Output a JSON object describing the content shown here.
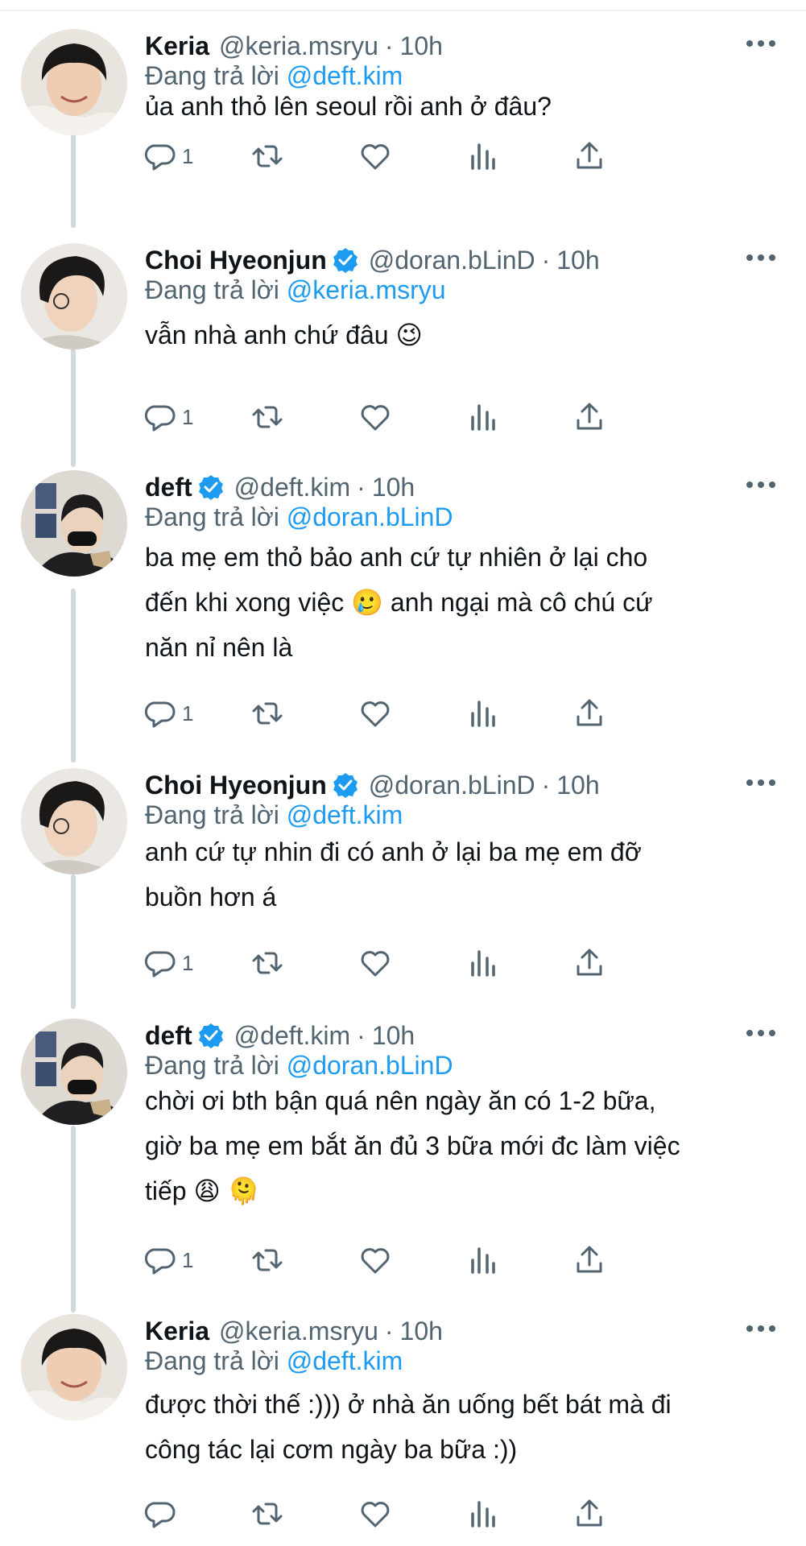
{
  "reply_prefix": "Đang trả lời",
  "tweets": [
    {
      "name": "Keria",
      "verified": false,
      "handle": "@keria.msryu",
      "separator": "·",
      "time": "10h",
      "replying_to": "@deft.kim",
      "lines": [
        "ủa anh thỏ lên seoul rồi anh ở đâu?"
      ],
      "reply_count": "1"
    },
    {
      "name": "Choi Hyeonjun",
      "verified": true,
      "handle": "@doran.bLinD",
      "separator": "·",
      "time": "10h",
      "replying_to": "@keria.msryu",
      "lines": [
        "vẫn nhà anh chứ đâu 😉"
      ],
      "reply_count": "1"
    },
    {
      "name": "deft",
      "verified": true,
      "handle": "@deft.kim",
      "separator": "·",
      "time": "10h",
      "replying_to": "@doran.bLinD",
      "lines": [
        "ba mẹ em thỏ bảo anh cứ tự nhiên ở lại cho",
        "đến khi xong việc 🥲  anh ngại mà cô chú cứ",
        "năn nỉ nên là"
      ],
      "reply_count": "1"
    },
    {
      "name": "Choi Hyeonjun",
      "verified": true,
      "handle": "@doran.bLinD",
      "separator": "·",
      "time": "10h",
      "replying_to": "@deft.kim",
      "lines": [
        "anh cứ tự nhin đi có anh ở lại ba mẹ em đỡ",
        "buồn hơn á"
      ],
      "reply_count": "1"
    },
    {
      "name": "deft",
      "verified": true,
      "handle": "@deft.kim",
      "separator": "·",
      "time": "10h",
      "replying_to": "@doran.bLinD",
      "lines": [
        "chời ơi bth bận quá nên ngày ăn có 1-2 bữa,",
        "giờ ba mẹ em bắt ăn đủ 3 bữa mới đc làm việc",
        "tiếp 😩 🫠"
      ],
      "reply_count": "1"
    },
    {
      "name": "Keria",
      "verified": false,
      "handle": "@keria.msryu",
      "separator": "·",
      "time": "10h",
      "replying_to": "@deft.kim",
      "lines": [
        "được thời thế :))) ở nhà ăn uống bết bát mà đi",
        "công tác lại cơm ngày ba bữa :))"
      ],
      "reply_count": ""
    }
  ],
  "icons": {
    "more": "more-icon",
    "reply": "reply-icon",
    "retweet": "retweet-icon",
    "like": "like-icon",
    "views": "views-icon",
    "share": "share-icon",
    "verified": "verified-badge-icon"
  },
  "colors": {
    "text": "#0f1419",
    "secondary": "#536471",
    "link": "#1d9bf0",
    "thread_line": "#cfd9de"
  }
}
